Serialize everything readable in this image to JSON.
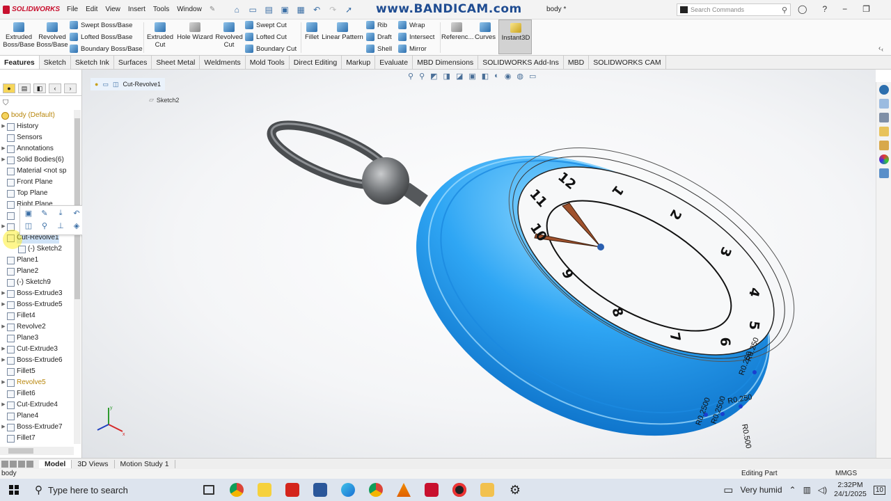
{
  "app": {
    "logo_text": "SOLIDWORKS",
    "document_title": "body *",
    "watermark": "www.BANDICAM.com",
    "search_placeholder": "Search Commands"
  },
  "menu": [
    "File",
    "Edit",
    "View",
    "Insert",
    "Tools",
    "Window"
  ],
  "ribbon": {
    "extruded_boss": "Extruded Boss/Base",
    "revolved_boss": "Revolved Boss/Base",
    "swept_boss": "Swept Boss/Base",
    "lofted_boss": "Lofted Boss/Base",
    "boundary_boss": "Boundary Boss/Base",
    "extruded_cut": "Extruded Cut",
    "hole_wizard": "Hole Wizard",
    "revolved_cut": "Revolved Cut",
    "swept_cut": "Swept Cut",
    "lofted_cut": "Lofted Cut",
    "boundary_cut": "Boundary Cut",
    "fillet": "Fillet",
    "linear_pattern": "Linear Pattern",
    "rib": "Rib",
    "draft": "Draft",
    "shell": "Shell",
    "wrap": "Wrap",
    "intersect": "Intersect",
    "mirror": "Mirror",
    "reference": "Referenc...",
    "curves": "Curves",
    "instant3d": "Instant3D"
  },
  "cm_tabs": [
    "Features",
    "Sketch",
    "Sketch Ink",
    "Surfaces",
    "Sheet Metal",
    "Weldments",
    "Mold Tools",
    "Direct Editing",
    "Markup",
    "Evaluate",
    "MBD Dimensions",
    "SOLIDWORKS Add-Ins",
    "MBD",
    "SOLIDWORKS CAM"
  ],
  "tree": {
    "root": "body (Default)",
    "items": [
      {
        "label": "History",
        "exp": true
      },
      {
        "label": "Sensors",
        "exp": false
      },
      {
        "label": "Annotations",
        "exp": true
      },
      {
        "label": "Solid Bodies(6)",
        "exp": true
      },
      {
        "label": "Material <not sp",
        "exp": false
      },
      {
        "label": "Front Plane",
        "exp": false
      },
      {
        "label": "Top Plane",
        "exp": false
      },
      {
        "label": "Right Plane",
        "exp": false
      },
      {
        "label": "",
        "exp": false
      },
      {
        "label": "",
        "exp": true
      },
      {
        "label": "Cut-Revolve1",
        "exp": false,
        "sel": true
      },
      {
        "label": "(-) Sketch2",
        "exp": false,
        "indent": true
      },
      {
        "label": "Plane1",
        "exp": false
      },
      {
        "label": "Plane2",
        "exp": false
      },
      {
        "label": "(-) Sketch9",
        "exp": false
      },
      {
        "label": "Boss-Extrude3",
        "exp": true
      },
      {
        "label": "Boss-Extrude5",
        "exp": true
      },
      {
        "label": "Fillet4",
        "exp": false
      },
      {
        "label": "Revolve2",
        "exp": true
      },
      {
        "label": "Plane3",
        "exp": false
      },
      {
        "label": "Cut-Extrude3",
        "exp": true
      },
      {
        "label": "Boss-Extrude6",
        "exp": true
      },
      {
        "label": "Fillet5",
        "exp": false
      },
      {
        "label": "Revolve5",
        "exp": true,
        "warn": true
      },
      {
        "label": "Fillet6",
        "exp": false
      },
      {
        "label": "Cut-Extrude4",
        "exp": true
      },
      {
        "label": "Plane4",
        "exp": false
      },
      {
        "label": "Boss-Extrude7",
        "exp": true
      },
      {
        "label": "Fillet7",
        "exp": false
      }
    ]
  },
  "breadcrumb": {
    "feature": "Cut-Revolve1",
    "sketch": "Sketch2"
  },
  "model": {
    "dial_numbers": [
      "12",
      "11",
      "10",
      "9",
      "8",
      "7",
      "6",
      "5",
      "4",
      "3",
      "2",
      "1"
    ],
    "dimensions": [
      "R0.250",
      "R0.250",
      "R0.250",
      "R0.2500",
      "R0.2500",
      "R0.500"
    ],
    "body_color": "#2fa6f4",
    "ring_color": "#5a5d60"
  },
  "bottom_tabs": [
    "Model",
    "3D Views",
    "Motion Study 1"
  ],
  "status": {
    "left": "body",
    "middle": "Editing Part",
    "units": "MMGS"
  },
  "taskbar": {
    "search": "Type here to search",
    "weather": "Very humid",
    "time": "2:32PM",
    "date": "24/1/2025",
    "notifications": "10"
  }
}
